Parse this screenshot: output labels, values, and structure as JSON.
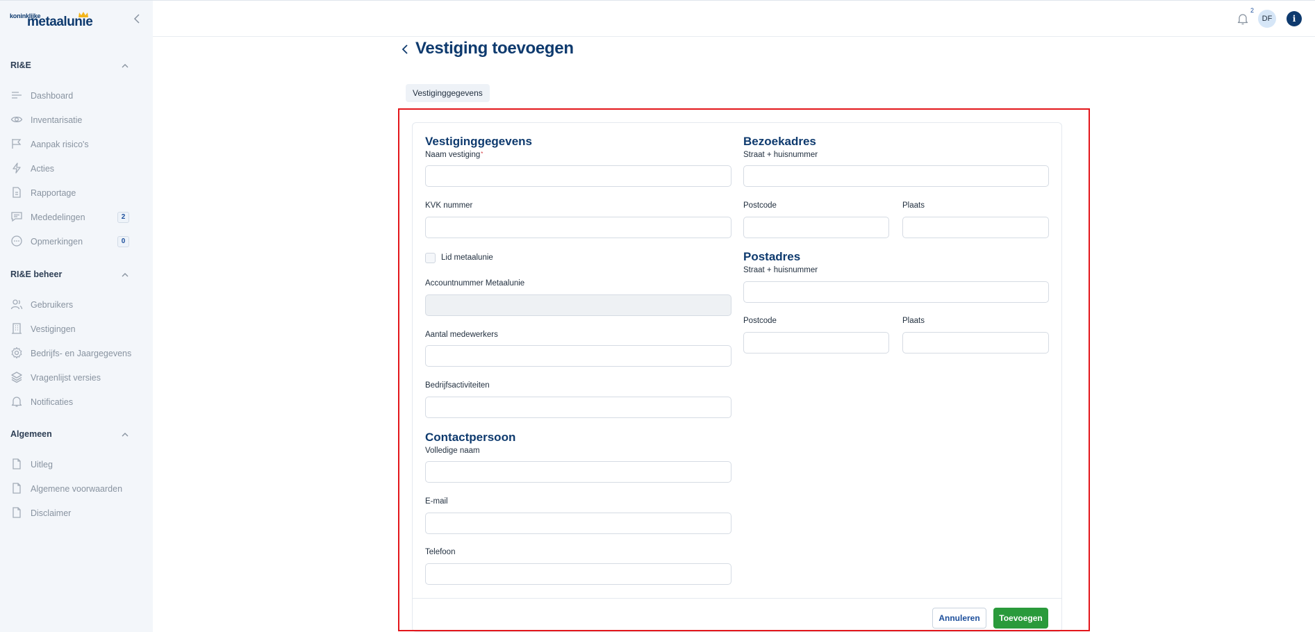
{
  "brand": {
    "logo_small": "koninklijke",
    "logo_big": "metaalunie",
    "accent": "#0e3a6e",
    "primary_action": "#2a9a3b"
  },
  "sidebar": {
    "sections": [
      {
        "title": "RI&E",
        "items": [
          {
            "label": "Dashboard",
            "icon": "menu-lines-icon"
          },
          {
            "label": "Inventarisatie",
            "icon": "eye-icon"
          },
          {
            "label": "Aanpak risico's",
            "icon": "flag-icon"
          },
          {
            "label": "Acties",
            "icon": "lightning-icon"
          },
          {
            "label": "Rapportage",
            "icon": "document-icon"
          },
          {
            "label": "Mededelingen",
            "icon": "message-icon",
            "badge": "2"
          },
          {
            "label": "Opmerkingen",
            "icon": "chat-icon",
            "badge": "0"
          }
        ]
      },
      {
        "title": "RI&E beheer",
        "items": [
          {
            "label": "Gebruikers",
            "icon": "users-icon"
          },
          {
            "label": "Vestigingen",
            "icon": "building-icon"
          },
          {
            "label": "Bedrijfs- en Jaargegevens",
            "icon": "gear-icon"
          },
          {
            "label": "Vragenlijst versies",
            "icon": "layers-icon"
          },
          {
            "label": "Notificaties",
            "icon": "bell-icon"
          }
        ]
      },
      {
        "title": "Algemeen",
        "items": [
          {
            "label": "Uitleg",
            "icon": "file-icon"
          },
          {
            "label": "Algemene voorwaarden",
            "icon": "file-icon"
          },
          {
            "label": "Disclaimer",
            "icon": "file-icon"
          }
        ]
      }
    ]
  },
  "topbar": {
    "notification_count": "2",
    "avatar_initials": "DF",
    "info_label": "i"
  },
  "page": {
    "title": "Vestiging toevoegen",
    "tab": "Vestiginggegevens"
  },
  "form": {
    "vestiging": {
      "title": "Vestiginggegevens",
      "naam_label": "Naam vestiging",
      "naam_required": "*",
      "kvk_label": "KVK nummer",
      "lid_label": "Lid metaalunie",
      "account_label": "Accountnummer Metaalunie",
      "medewerkers_label": "Aantal medewerkers",
      "activiteiten_label": "Bedrijfsactiviteiten"
    },
    "contact": {
      "title": "Contactpersoon",
      "naam_label": "Volledige naam",
      "email_label": "E-mail",
      "telefoon_label": "Telefoon"
    },
    "bezoekadres": {
      "title": "Bezoekadres",
      "straat_label": "Straat + huisnummer",
      "postcode_label": "Postcode",
      "plaats_label": "Plaats"
    },
    "postadres": {
      "title": "Postadres",
      "straat_label": "Straat + huisnummer",
      "postcode_label": "Postcode",
      "plaats_label": "Plaats"
    },
    "buttons": {
      "cancel": "Annuleren",
      "submit": "Toevoegen"
    }
  }
}
